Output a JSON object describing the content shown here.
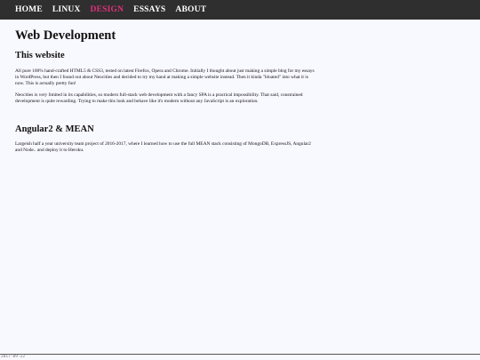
{
  "nav": {
    "items": [
      {
        "label": "HOME"
      },
      {
        "label": "LINUX"
      },
      {
        "label": "DESIGN",
        "active": true
      },
      {
        "label": "ESSAYS"
      },
      {
        "label": "ABOUT"
      }
    ],
    "active_color": "#e0307a"
  },
  "main": {
    "title": "Web Development",
    "sections": [
      {
        "heading": "This website",
        "paragraphs": [
          "All pure 100% hand-crafted HTML5 & CSS3, tested on latest Firefox, Opera and Chrome. Initially I thought about just making a simple blog for my essays in WordPress, but then I found out about Neocities and decided to try my hand at making a simple website instead. Then it kinda \"bloated\" into what it is now. This is actually pretty fun!",
          "Neocities is very limited in its capabilities, so modern full-stack web development with a fancy SPA is a practical impossibility. That said, constrained development is quite rewarding. Trying to make this look and behave like it's modern without any JavaScript is an exploration."
        ]
      },
      {
        "heading": "Angular2 & MEAN",
        "paragraphs": [
          "Largeish half a year university team project of 2016-2017, where I learned how to use the full MEAN stack consisting of MongoDB, ExpressJS, Angular2 and Node.. and deploy it to Heroku."
        ]
      }
    ]
  },
  "footer": {
    "date": "2017-09-22"
  }
}
